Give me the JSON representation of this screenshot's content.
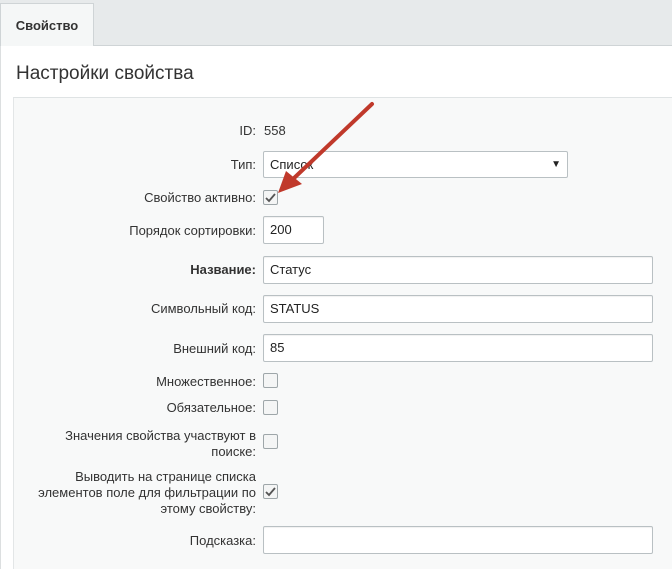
{
  "tabs": [
    {
      "label": "Свойство"
    }
  ],
  "panel": {
    "title": "Настройки свойства"
  },
  "form": {
    "id": {
      "label": "ID:",
      "value": "558"
    },
    "type": {
      "label": "Тип:",
      "value": "Список"
    },
    "active": {
      "label": "Свойство активно:",
      "checked": true
    },
    "sort": {
      "label": "Порядок сортировки:",
      "value": "200"
    },
    "name": {
      "label": "Название:",
      "value": "Статус"
    },
    "code": {
      "label": "Символьный код:",
      "value": "STATUS"
    },
    "xml_id": {
      "label": "Внешний код:",
      "value": "85"
    },
    "multiple": {
      "label": "Множественное:",
      "checked": false
    },
    "required": {
      "label": "Обязательное:",
      "checked": false
    },
    "searchable": {
      "label1": "Значения свойства участвуют в",
      "label2": "поиске:",
      "checked": false
    },
    "filtrable": {
      "label1": "Выводить на странице списка",
      "label2": "элементов поле для фильтрации по",
      "label3": "этому свойству:",
      "checked": true
    },
    "hint": {
      "label": "Подсказка:",
      "value": ""
    }
  },
  "colors": {
    "annotation_arrow": "#c0392b"
  }
}
